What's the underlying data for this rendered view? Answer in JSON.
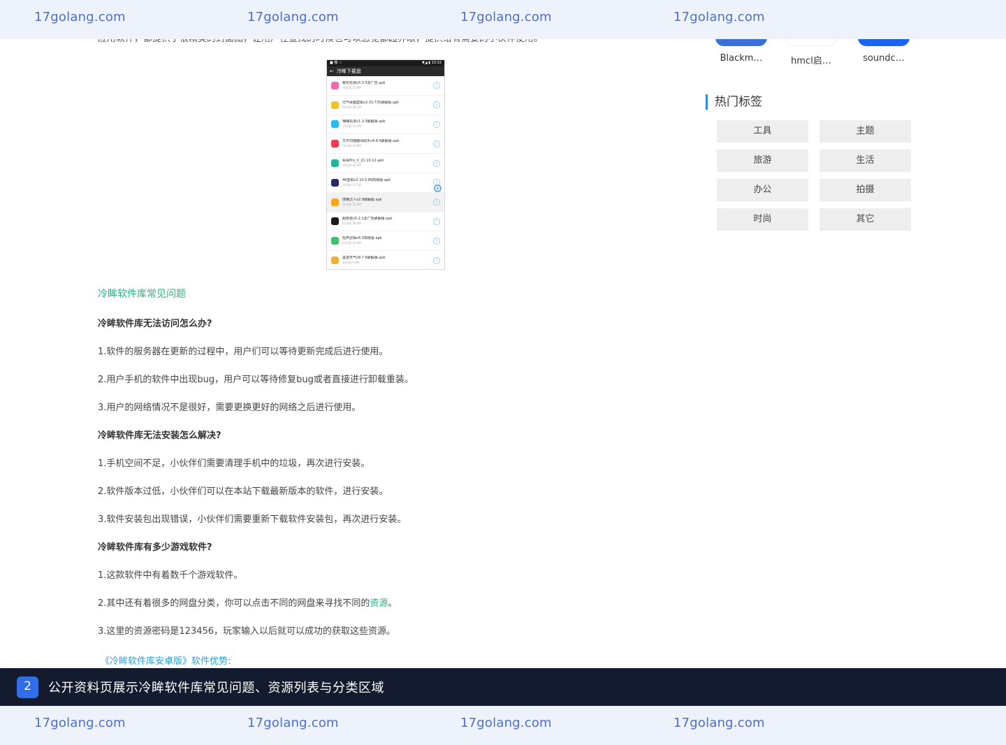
{
  "watermark": {
    "top": [
      "17golang.com",
      "17golang.com",
      "17golang.com",
      "17golang.com"
    ],
    "bottom": [
      "17golang.com",
      "17golang.com",
      "17golang.com",
      "17golang.com"
    ]
  },
  "intro_cut": "应用软件，都提供了很精美的封面图，让用户在查找的时候也可以感觉都超养眼，提供给有需要的小伙伴使用。",
  "phone": {
    "status_left": "■ 微 ☆",
    "status_right": "▼◢ ▮ 10:32",
    "header": "冷眸下载盘",
    "rows": [
      {
        "name": "樱花花漫v5.0.5去广告.apk",
        "meta": "16天前      37.6M",
        "color": "#f06ab0"
      },
      {
        "name": "元气桌面壁纸v2.33.735破解版.apk",
        "meta": "16天前      28.1M",
        "color": "#f2c12e"
      },
      {
        "name": "嗨嗨花漫v1.3.3破解版.apk",
        "meta": "16天前      18.5M",
        "color": "#2bb9f0"
      },
      {
        "name": "文字扫描翻译助手v4.8.5破解版.apk",
        "meta": "16天前      26.8M",
        "color": "#ee3b4e"
      },
      {
        "name": "看看Pro_V_21.10.12.apk",
        "meta": "20天前      18.5M",
        "color": "#2ab39a"
      },
      {
        "name": "4K壁纸v2.10.0.89高级版.apk",
        "meta": "20天前      22.1M",
        "color": "#2a2a6a"
      },
      {
        "name": "搜索达人v2.9破解版.apk",
        "meta": "20天前      33.2M",
        "color": "#f5a623"
      },
      {
        "name": "超级君v5.2.1去广告破解版.apk",
        "meta": "22天前      29.4M",
        "color": "#1a1a1a"
      },
      {
        "name": "轻声剪辑v6.3高级版.apk",
        "meta": "24天前      19.4M",
        "color": "#3cc26c"
      },
      {
        "name": "墨迹天气v8.7.6破解版.apk",
        "meta": "24天前      9.8M",
        "color": "#f3b13b"
      }
    ],
    "download_glyph": "↓"
  },
  "article": {
    "section_title": "冷眸软件库常见问题",
    "q1": "冷眸软件库无法访问怎么办?",
    "q1_answers": [
      "1.软件的服务器在更新的过程中，用户们可以等待更新完成后进行使用。",
      "2.用户手机的软件中出现bug，用户可以等待修复bug或者直接进行卸载重装。",
      "3.用户的网络情况不是很好，需要更换更好的网络之后进行使用。"
    ],
    "q2": "冷眸软件库无法安装怎么解决?",
    "q2_answers": [
      "1.手机空间不足，小伙伴们需要清理手机中的垃圾，再次进行安装。",
      "2.软件版本过低，小伙伴们可以在本站下载最新版本的软件，进行安装。",
      "3.软件安装包出现错误，小伙伴们需要重新下载软件安装包，再次进行安装。"
    ],
    "q3": "冷眸软件库有多少游戏软件?",
    "q3_a1": "1.这款软件中有着数千个游戏软件。",
    "q3_a2_pre": "2.其中还有着很多的网盘分类，你可以点击不同的网盘来寻找不同的",
    "q3_a2_link": "资源",
    "q3_a2_post": "。",
    "q3_a3": "3.这里的资源密码是123456，玩家输入以后就可以成功的获取这些资源。",
    "advantages_title": "《冷眸软件库安卓版》软件优势:"
  },
  "related_apps": [
    {
      "name": "Blackm…",
      "color": "#3a6fd6"
    },
    {
      "name": "hmcl启…",
      "color": "#5a4632"
    },
    {
      "name": "soundc…",
      "color": "#1e63f0"
    }
  ],
  "hot_tags": {
    "title": "热门标签",
    "tags": [
      "工具",
      "主题",
      "旅游",
      "生活",
      "办公",
      "拍摄",
      "时尚",
      "其它"
    ]
  },
  "caption": {
    "number": "2",
    "text": "公开资料页展示冷眸软件库常见问题、资源列表与分类区域"
  }
}
